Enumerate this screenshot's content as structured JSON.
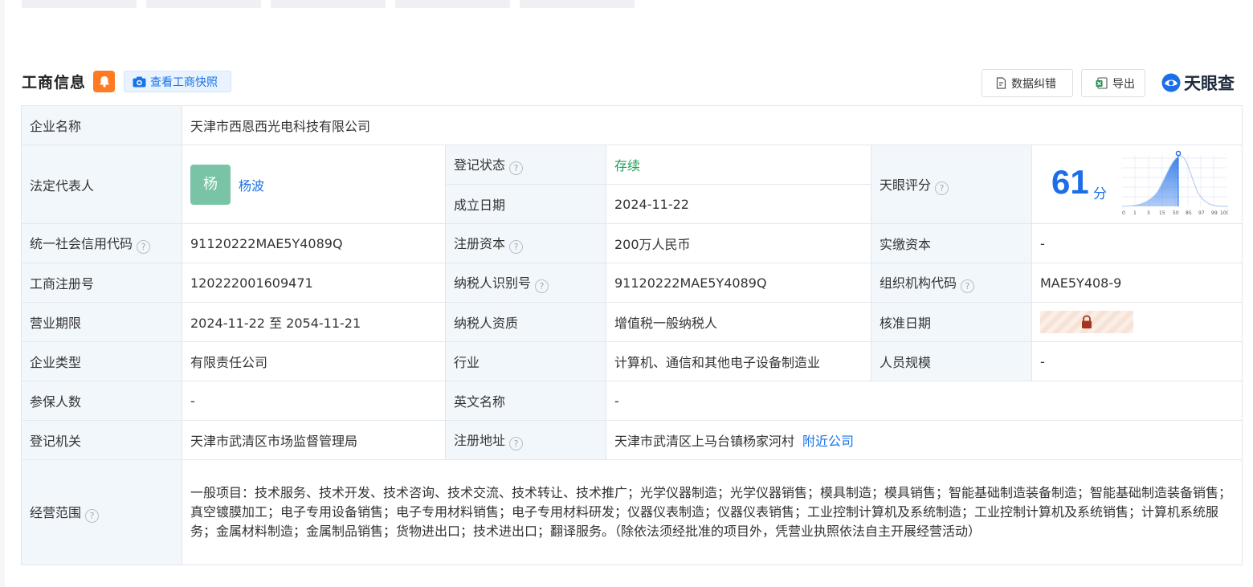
{
  "header": {
    "title": "工商信息",
    "snapshot_label": "查看工商快照",
    "correct_label": "数据纠错",
    "export_label": "导出",
    "logo_text": "天眼查"
  },
  "colors": {
    "accent": "#1a73e8",
    "label_bg": "#f2f7fc",
    "status_green": "#1aa155",
    "bell_orange": "#ff7a22",
    "avatar_green": "#79c3a6"
  },
  "company": {
    "name_label": "企业名称",
    "name": "天津市西恩西光电科技有限公司",
    "legal_rep_label": "法定代表人",
    "legal_rep_avatar": "杨",
    "legal_rep": "杨波",
    "reg_status_label": "登记状态",
    "reg_status": "存续",
    "founded_label": "成立日期",
    "founded": "2024-11-22",
    "tianyan_score_label": "天眼评分",
    "score": "61",
    "score_unit": "分",
    "credit_code_label": "统一社会信用代码",
    "credit_code": "91120222MAE5Y4089Q",
    "reg_capital_label": "注册资本",
    "reg_capital": "200万人民币",
    "paid_capital_label": "实缴资本",
    "paid_capital": "-",
    "reg_no_label": "工商注册号",
    "reg_no": "120222001609471",
    "taxpayer_id_label": "纳税人识别号",
    "taxpayer_id": "91120222MAE5Y4089Q",
    "org_code_label": "组织机构代码",
    "org_code": "MAE5Y408-9",
    "term_label": "营业期限",
    "term": "2024-11-22 至 2054-11-21",
    "taxpayer_qual_label": "纳税人资质",
    "taxpayer_qual": "增值税一般纳税人",
    "approve_date_label": "核准日期",
    "type_label": "企业类型",
    "type": "有限责任公司",
    "industry_label": "行业",
    "industry": "计算机、通信和其他电子设备制造业",
    "staff_label": "人员规模",
    "staff": "-",
    "insured_label": "参保人数",
    "insured": "-",
    "english_name_label": "英文名称",
    "english_name": "-",
    "authority_label": "登记机关",
    "authority": "天津市武清区市场监督管理局",
    "address_label": "注册地址",
    "address": "天津市武清区上马台镇杨家河村",
    "nearby_label": "附近公司",
    "scope_label": "经营范围",
    "scope": "一般项目：技术服务、技术开发、技术咨询、技术交流、技术转让、技术推广；光学仪器制造；光学仪器销售；模具制造；模具销售；智能基础制造装备制造；智能基础制造装备销售；真空镀膜加工；电子专用设备销售；电子专用材料销售；电子专用材料研发；仪器仪表制造；仪器仪表销售；工业控制计算机及系统制造；工业控制计算机及系统销售；计算机系统服务；金属材料制造；金属制品销售；货物进出口；技术进出口；翻译服务。（除依法须经批准的项目外，凭营业执照依法自主开展经营活动）"
  },
  "score_chart": {
    "ticks": [
      "0",
      "1",
      "3",
      "15",
      "50",
      "85",
      "97",
      "99",
      "100"
    ]
  }
}
